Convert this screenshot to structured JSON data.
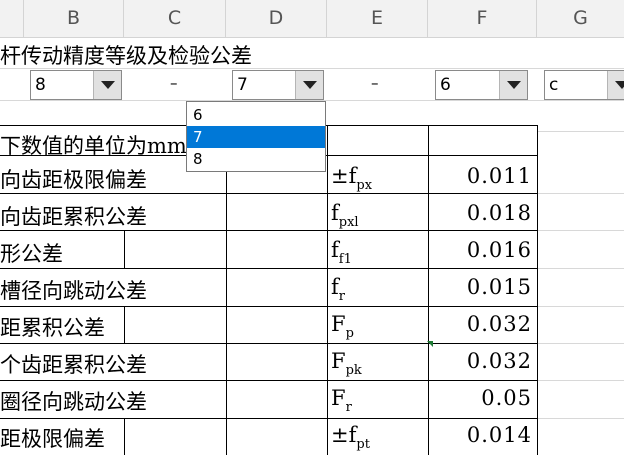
{
  "columns": [
    "B",
    "C",
    "D",
    "E",
    "F",
    "G"
  ],
  "title": "杆传动精度等级及检验公差",
  "selectors": {
    "grade_1": "8",
    "grade_2": "7",
    "grade_3": "6",
    "fit": "c",
    "separator": "–"
  },
  "dropdown_list": {
    "options": [
      "6",
      "7",
      "8"
    ],
    "selected": "7"
  },
  "unit_note": "下数值的单位为mm",
  "rows": [
    {
      "label": "向齿距极限偏差",
      "prefix": "±",
      "base": "f",
      "sub": "px",
      "value": "0.011"
    },
    {
      "label": "向齿距累积公差",
      "prefix": "",
      "base": "f",
      "sub": "pxl",
      "value": "0.018"
    },
    {
      "label": "形公差",
      "prefix": "",
      "base": "f",
      "sub": "f1",
      "value": "0.016"
    },
    {
      "label": "槽径向跳动公差",
      "prefix": "",
      "base": "f",
      "sub": "r",
      "value": "0.015"
    },
    {
      "label": "距累积公差",
      "prefix": "",
      "base": "F",
      "sub": "p",
      "value": "0.032"
    },
    {
      "label": "个齿距累积公差",
      "prefix": "",
      "base": "F",
      "sub": "pk",
      "value": "0.032"
    },
    {
      "label": "圈径向跳动公差",
      "prefix": "",
      "base": "F",
      "sub": "r",
      "value": "0.05"
    },
    {
      "label": "距极限偏差",
      "prefix": "±",
      "base": "f",
      "sub": "pt",
      "value": "0.014"
    }
  ],
  "colors": {
    "selection": "#0078d7",
    "header_bg": "#f2f2f2",
    "grid": "#d8d8d8",
    "comment_marker": "#1e7b34"
  }
}
